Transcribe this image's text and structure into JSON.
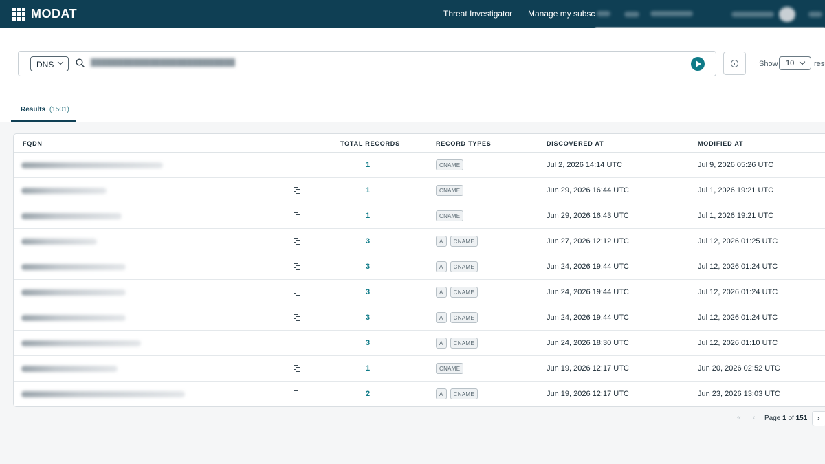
{
  "brand": {
    "name": "MODAT"
  },
  "nav": {
    "threat_investigator": "Threat Investigator",
    "manage_subscription": "Manage my subscription"
  },
  "search": {
    "type_selected": "DNS",
    "show_label": "Show",
    "page_size": "10",
    "results_suffix": "results"
  },
  "tabs": [
    {
      "label": "Results",
      "count": "(1501)"
    }
  ],
  "table": {
    "columns": [
      "FQDN",
      "TOTAL RECORDS",
      "RECORD TYPES",
      "DISCOVERED AT",
      "MODIFIED AT"
    ],
    "rows": [
      {
        "total": "1",
        "types": [
          "CNAME"
        ],
        "discovered": "Jul 2, 2026 14:14 UTC",
        "modified": "Jul 9, 2026 05:26 UTC"
      },
      {
        "total": "1",
        "types": [
          "CNAME"
        ],
        "discovered": "Jun 29, 2026 16:44 UTC",
        "modified": "Jul 1, 2026 19:21 UTC"
      },
      {
        "total": "1",
        "types": [
          "CNAME"
        ],
        "discovered": "Jun 29, 2026 16:43 UTC",
        "modified": "Jul 1, 2026 19:21 UTC"
      },
      {
        "total": "3",
        "types": [
          "A",
          "CNAME"
        ],
        "discovered": "Jun 27, 2026 12:12 UTC",
        "modified": "Jul 12, 2026 01:25 UTC"
      },
      {
        "total": "3",
        "types": [
          "A",
          "CNAME"
        ],
        "discovered": "Jun 24, 2026 19:44 UTC",
        "modified": "Jul 12, 2026 01:24 UTC"
      },
      {
        "total": "3",
        "types": [
          "A",
          "CNAME"
        ],
        "discovered": "Jun 24, 2026 19:44 UTC",
        "modified": "Jul 12, 2026 01:24 UTC"
      },
      {
        "total": "3",
        "types": [
          "A",
          "CNAME"
        ],
        "discovered": "Jun 24, 2026 19:44 UTC",
        "modified": "Jul 12, 2026 01:24 UTC"
      },
      {
        "total": "3",
        "types": [
          "A",
          "CNAME"
        ],
        "discovered": "Jun 24, 2026 18:30 UTC",
        "modified": "Jul 12, 2026 01:10 UTC"
      },
      {
        "total": "1",
        "types": [
          "CNAME"
        ],
        "discovered": "Jun 19, 2026 12:17 UTC",
        "modified": "Jun 20, 2026 02:52 UTC"
      },
      {
        "total": "2",
        "types": [
          "A",
          "CNAME"
        ],
        "discovered": "Jun 19, 2026 12:17 UTC",
        "modified": "Jun 23, 2026 13:03 UTC"
      }
    ]
  },
  "pagination": {
    "page_word": "Page",
    "current": "1",
    "of_word": "of",
    "total": "151",
    "first_glyph": "«",
    "prev_glyph": "‹",
    "next_glyph": "›"
  },
  "colors": {
    "nav_bg": "#0f3f54",
    "accent": "#0f7b88"
  },
  "icons": {
    "search": "search-icon",
    "copy": "copy-icon",
    "info": "info-icon",
    "run": "play-icon"
  }
}
